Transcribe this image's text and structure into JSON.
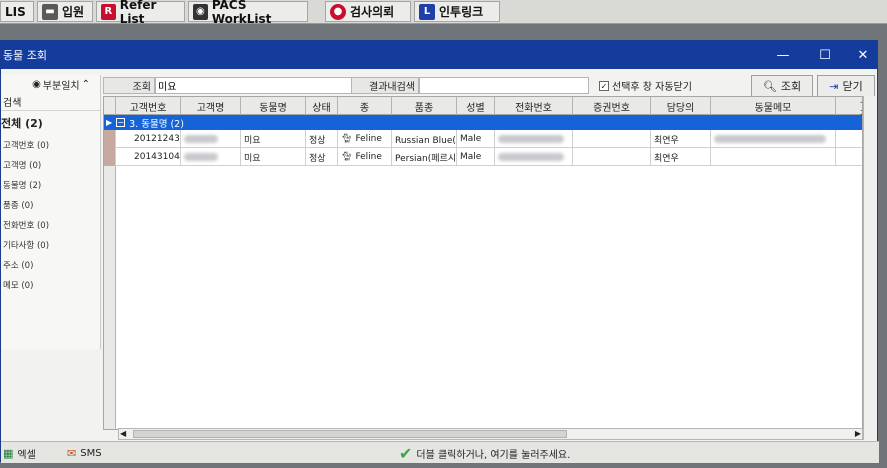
{
  "taskbar": {
    "items": [
      {
        "label": "LIS"
      },
      {
        "label": "입원"
      },
      {
        "label": "Refer List"
      },
      {
        "label": "PACS WorkList"
      },
      {
        "label": "검사의뢰"
      },
      {
        "label": "인투링크"
      }
    ]
  },
  "window": {
    "title": "동물 조회",
    "minimize": "—",
    "maximize": "☐",
    "close": "✕"
  },
  "left_panel": {
    "match_mode": "부분일치",
    "search_label": "검색",
    "total": "전체 (2)",
    "filters": [
      {
        "label": "고객번호 (0)"
      },
      {
        "label": "고객명 (0)"
      },
      {
        "label": "동물명 (2)"
      },
      {
        "label": "품종 (0)"
      },
      {
        "label": "전화번호 (0)"
      },
      {
        "label": "기타사항 (0)"
      },
      {
        "label": "주소 (0)"
      },
      {
        "label": "메모 (0)"
      }
    ]
  },
  "search": {
    "label": "조회",
    "value": "미요",
    "result_search_label": "결과내검색",
    "result_search_value": "",
    "auto_close_label": "선택후 창 자동닫기",
    "auto_close_checked": "✓",
    "search_button": "조회",
    "close_button": "닫기"
  },
  "grid": {
    "columns": [
      "고객번호",
      "고객명",
      "동물명",
      "상태",
      "종",
      "품종",
      "성별",
      "전화번호",
      "증권번호",
      "담당의",
      "동물메모",
      "고객"
    ],
    "group_label": "3. 동물명 (2)",
    "rows": [
      {
        "customer_no": "20121243",
        "animal_name": "미요",
        "status": "정상",
        "species": "Feline",
        "breed": "Russian Blue(러",
        "sex": "Male",
        "doctor": "최연우"
      },
      {
        "customer_no": "20143104",
        "animal_name": "미요",
        "status": "정상",
        "species": "Feline",
        "breed": "Persian(페르시",
        "sex": "Male",
        "doctor": "최연우"
      }
    ]
  },
  "bottom": {
    "excel": "엑셀",
    "sms": "SMS",
    "hint": "더블 클릭하거나, 여기를 눌러주세요."
  }
}
